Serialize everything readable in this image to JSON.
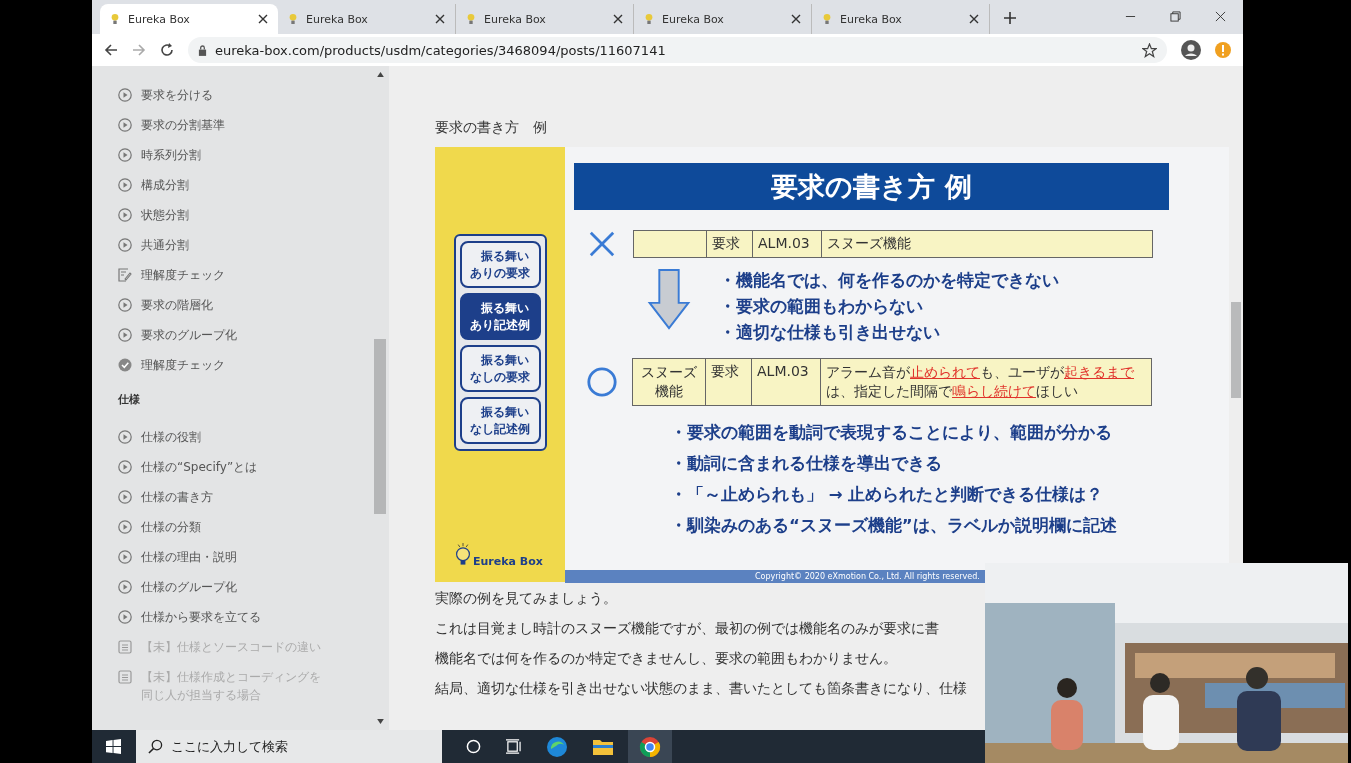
{
  "tabs": [
    {
      "label": "Eureka Box",
      "selected": true
    },
    {
      "label": "Eureka Box",
      "selected": false
    },
    {
      "label": "Eureka Box",
      "selected": false
    },
    {
      "label": "Eureka Box",
      "selected": false
    },
    {
      "label": "Eureka Box",
      "selected": false
    }
  ],
  "address_bar": {
    "url": "eureka-box.com/products/usdm/categories/3468094/posts/11607141"
  },
  "sidebar": {
    "groups": [
      {
        "items": [
          {
            "label": "要求を分ける",
            "kind": "lesson",
            "disabled": false
          },
          {
            "label": "要求の分割基準",
            "kind": "lesson",
            "disabled": false
          },
          {
            "label": "時系列分割",
            "kind": "lesson",
            "disabled": false
          },
          {
            "label": "構成分割",
            "kind": "lesson",
            "disabled": false
          },
          {
            "label": "状態分割",
            "kind": "lesson",
            "disabled": false
          },
          {
            "label": "共通分割",
            "kind": "lesson",
            "disabled": false
          },
          {
            "label": "理解度チェック",
            "kind": "quiz",
            "disabled": false
          },
          {
            "label": "要求の階層化",
            "kind": "lesson",
            "disabled": false
          },
          {
            "label": "要求のグループ化",
            "kind": "lesson",
            "disabled": false
          },
          {
            "label": "理解度チェック",
            "kind": "completed",
            "disabled": false
          }
        ]
      },
      {
        "heading": "仕様",
        "items": [
          {
            "label": "仕様の役割",
            "kind": "lesson",
            "disabled": false
          },
          {
            "label": "仕様の“Specify”とは",
            "kind": "lesson",
            "disabled": false
          },
          {
            "label": "仕様の書き方",
            "kind": "lesson",
            "disabled": false
          },
          {
            "label": "仕様の分類",
            "kind": "lesson",
            "disabled": false
          },
          {
            "label": "仕様の理由・説明",
            "kind": "lesson",
            "disabled": false
          },
          {
            "label": "仕様のグループ化",
            "kind": "lesson",
            "disabled": false
          },
          {
            "label": "仕様から要求を立てる",
            "kind": "lesson",
            "disabled": false
          },
          {
            "label": "【未】仕様とソースコードの違い",
            "kind": "document",
            "disabled": true
          },
          {
            "label": "【未】仕様作成とコーディングを同じ人が担当する場合",
            "kind": "document",
            "disabled": true
          }
        ]
      }
    ]
  },
  "content": {
    "heading": "要求の書き方　例",
    "slide": {
      "title": "要求の書き方  例",
      "nav": [
        {
          "label": "振る舞いありの要求",
          "selected": false
        },
        {
          "label": "振る舞いあり記述例",
          "selected": true
        },
        {
          "label": "振る舞いなしの要求",
          "selected": false
        },
        {
          "label": "振る舞いなし記述例",
          "selected": false
        }
      ],
      "logo": "Eureka Box",
      "bad_row": {
        "cells": [
          "",
          "要求",
          "ALM.03",
          "スヌーズ機能"
        ]
      },
      "bad_points": [
        "・機能名では、何を作るのかを特定できない",
        "・要求の範囲もわからない",
        "・適切な仕様も引き出せない"
      ],
      "good_row": {
        "cells": [
          "スヌーズ機能",
          "要求",
          "ALM.03"
        ],
        "description": [
          {
            "text": "アラーム音が",
            "emphasis": false
          },
          {
            "text": "止められて",
            "emphasis": true
          },
          {
            "text": "も、ユーザが",
            "emphasis": false
          },
          {
            "text": "起きるまで",
            "emphasis": true
          },
          {
            "text": "は、指定した間隔で",
            "emphasis": false
          },
          {
            "text": "鳴らし続けて",
            "emphasis": true
          },
          {
            "text": "ほしい",
            "emphasis": false
          }
        ]
      },
      "good_points": [
        "・要求の範囲を動詞で表現することにより、範囲が分かる",
        "・動詞に含まれる仕様を導出できる",
        "・「～止められも」 → 止められたと判断できる仕様は？",
        "・馴染みのある“スヌーズ機能”は、ラベルか説明欄に記述"
      ],
      "copyright": "Copyright© 2020 eXmotion Co., Ltd. All rights reserved."
    },
    "paragraphs": [
      "実際の例を見てみましょう。",
      "これは目覚まし時計のスヌーズ機能ですが、最初の例では機能名のみが要求に書",
      "機能名では何を作るのか特定できませんし、要求の範囲もわかりません。",
      "結局、適切な仕様を引き出せない状態のまま、書いたとしても箇条書きになり、仕様"
    ]
  },
  "taskbar": {
    "search": {
      "placeholder": "ここに入力して検索"
    }
  }
}
